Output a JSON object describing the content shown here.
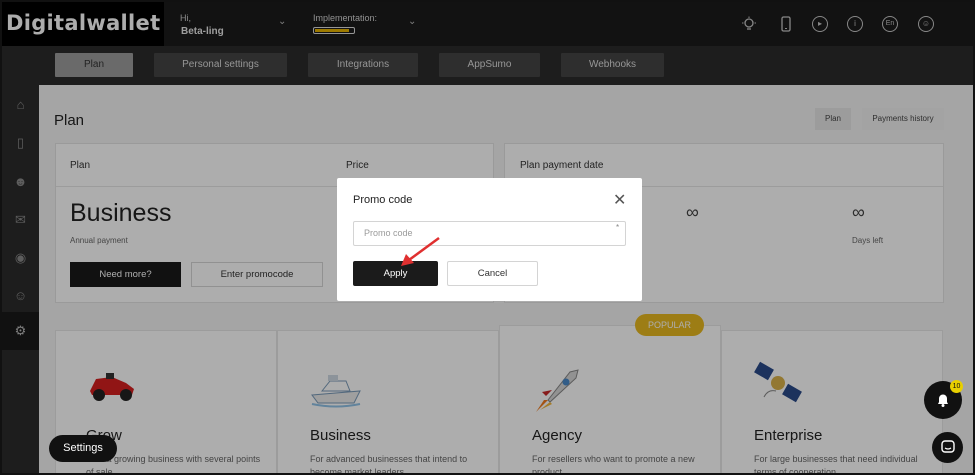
{
  "app": {
    "logo": "Digitalwallet"
  },
  "header": {
    "greeting": "Hi,",
    "username": "Beta-ling",
    "implementation_label": "Implementation:",
    "implementation_progress": 0.9,
    "language": "En"
  },
  "tabs": [
    {
      "label": "Plan",
      "active": true
    },
    {
      "label": "Personal settings",
      "active": false
    },
    {
      "label": "Integrations",
      "active": false
    },
    {
      "label": "AppSumo",
      "active": false
    },
    {
      "label": "Webhooks",
      "active": false
    }
  ],
  "page": {
    "title": "Plan",
    "toggle": [
      "Plan",
      "Payments history"
    ]
  },
  "plan_card": {
    "col_plan": "Plan",
    "col_price": "Price",
    "plan_name": "Business",
    "billing": "Annual payment",
    "need_more": "Need more?",
    "enter_promo": "Enter promocode"
  },
  "payment_card": {
    "title": "Plan payment date",
    "value_symbol": "∞",
    "days_left_value": "∞",
    "days_left_label": "Days left"
  },
  "plans": [
    {
      "name": "Grow",
      "desc": "e for a growing business with several points of sale"
    },
    {
      "name": "Business",
      "desc": "For advanced businesses that intend to become market leaders"
    },
    {
      "name": "Agency",
      "desc": "For resellers who want to promote a new product"
    },
    {
      "name": "Enterprise",
      "desc": "For large businesses that need individual terms of cooperation"
    }
  ],
  "popular_badge": "POPULAR",
  "modal": {
    "title": "Promo code",
    "input_placeholder": "Promo code",
    "required_mark": "*",
    "apply": "Apply",
    "cancel": "Cancel"
  },
  "floating": {
    "settings": "Settings",
    "notification_count": "10"
  },
  "colors": {
    "accent": "#e8b400",
    "dark": "#1b1b1b",
    "popular": "#e7b81f"
  }
}
